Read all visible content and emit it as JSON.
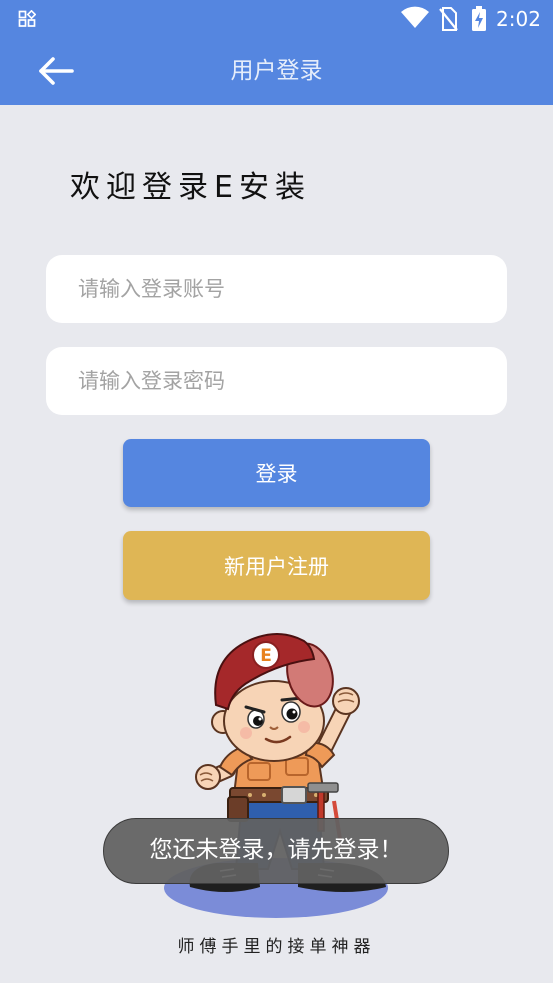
{
  "status_bar": {
    "time": "2:02",
    "icons": {
      "notification": "widgets-icon",
      "wifi": "wifi-icon",
      "sim": "no-sim-icon",
      "battery": "battery-charging-icon"
    }
  },
  "app_bar": {
    "title": "用户登录",
    "back_icon": "arrow-left-icon"
  },
  "welcome": {
    "heading": "欢迎登录E安装"
  },
  "form": {
    "account": {
      "value": "",
      "placeholder": "请输入登录账号"
    },
    "password": {
      "value": "",
      "placeholder": "请输入登录密码"
    }
  },
  "buttons": {
    "login": "登录",
    "register": "新用户注册"
  },
  "mascot": {
    "cap_logo_letter": "E"
  },
  "toast": {
    "message": "您还未登录，请先登录！"
  },
  "footer": {
    "slogan": "师傅手里的接单神器"
  },
  "colors": {
    "primary": "#5586e0",
    "register_button": "#dfb655",
    "background": "#e8e9ee",
    "card": "#ffffff"
  }
}
